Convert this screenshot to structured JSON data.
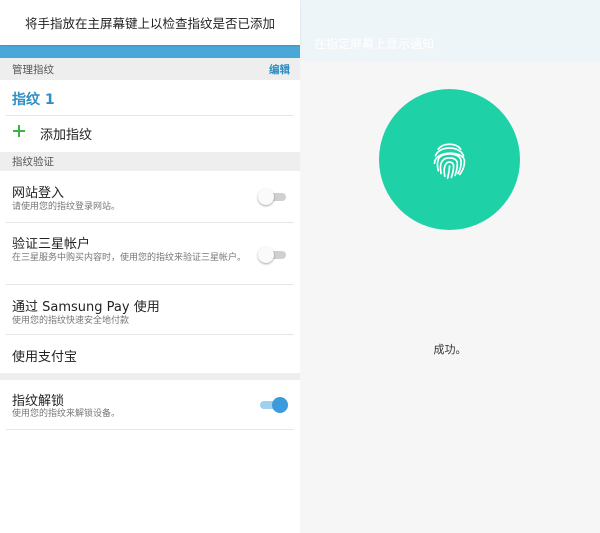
{
  "left": {
    "toast": "将手指放在主屏幕键上以检查指纹是否已添加",
    "manage_header": "管理指纹",
    "edit_label": "编辑",
    "fingerprint_item": "指纹 1",
    "add_fingerprint": "添加指纹",
    "verify_header": "指纹验证",
    "items": [
      {
        "title": "网站登入",
        "sub": "请使用您的指纹登录网站。",
        "toggle": "off"
      },
      {
        "title": "验证三星帐户",
        "sub": "在三星服务中购买内容时，使用您的指纹来验证三星帐户。",
        "toggle": "off"
      },
      {
        "title": "通过 Samsung Pay 使用",
        "sub": "使用您的指纹快速安全地付款"
      },
      {
        "title": "使用支付宝"
      },
      {
        "title": "指纹解锁",
        "sub": "使用您的指纹来解锁设备。",
        "toggle": "on"
      }
    ]
  },
  "right": {
    "top_text": "在指定屏幕上显示通知",
    "success": "成功。",
    "circle_color": "#1fd1a6"
  },
  "colors": {
    "accent_blue": "#2d8fc4",
    "bar_blue": "#4aa8d8",
    "toggle_on": "#3b9bdc"
  }
}
